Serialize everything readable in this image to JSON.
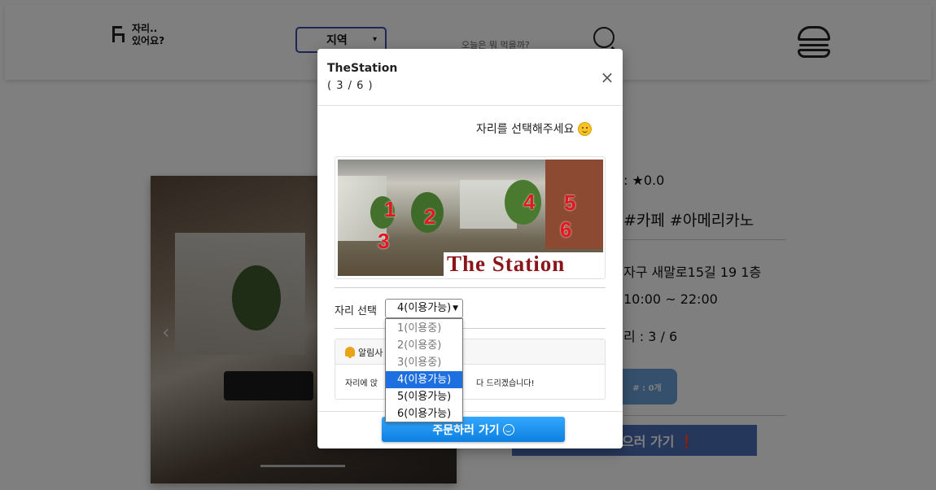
{
  "header": {
    "logo_line1": "자리..",
    "logo_line2": "있어요?",
    "region_label": "지역",
    "search_placeholder": "오늘은 뭐 먹을까?"
  },
  "store": {
    "rating": ": ★0.0",
    "tags": "#카페 #아메리카노",
    "address": "자구 새말로15길 19 1층",
    "hours": "10:00 ~ 22:00",
    "seats": "리 : 3 / 6",
    "cart_label": "# : 0개",
    "order_bg_label": "으러 가기 ❗"
  },
  "modal": {
    "title": "TheStation",
    "subtitle": "( 3 / 6 )",
    "close_symbol": "×",
    "prompt": "자리를 선택해주세요",
    "map_numbers": [
      "1",
      "2",
      "3",
      "4",
      "5",
      "6"
    ],
    "map_banner": "The Station",
    "seat_label": "자리 선택",
    "seat_selected": "4(이용가능)",
    "seat_options": [
      "1(이용중)",
      "2(이용중)",
      "3(이용중)",
      "4(이용가능)",
      "5(이용가능)",
      "6(이용가능)"
    ],
    "notice_title": "알림사",
    "notice_body_left": "자리에 앉",
    "notice_body_right": "다 드리겠습니다!",
    "order_button": "주문하러 가기"
  },
  "colors": {
    "accent": "#1e6fe0",
    "order_button": "#0d7fe0",
    "region_border": "#3a4fa8",
    "map_number": "#e3171f",
    "banner_text": "#8a1518"
  }
}
